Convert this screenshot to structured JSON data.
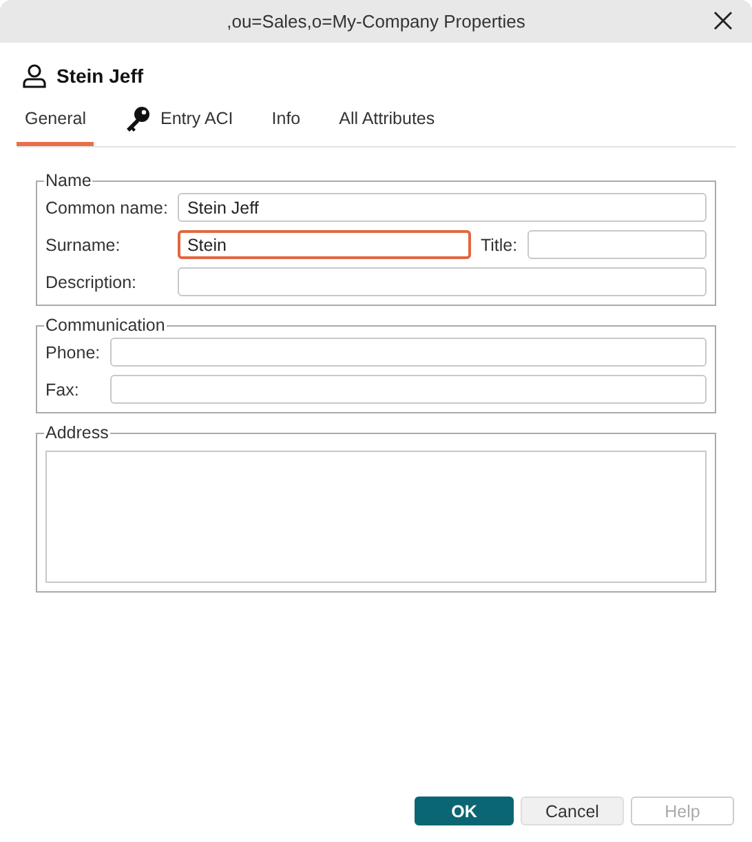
{
  "window": {
    "title": ",ou=Sales,o=My-Company Properties"
  },
  "header": {
    "name": "Stein Jeff"
  },
  "tabs": [
    {
      "label": "General",
      "selected": true,
      "kind": "text"
    },
    {
      "label": "Entry ACI",
      "selected": false,
      "kind": "key"
    },
    {
      "label": "Info",
      "selected": false,
      "kind": "text"
    },
    {
      "label": "All Attributes",
      "selected": false,
      "kind": "text"
    }
  ],
  "groups": [
    {
      "title": "Name",
      "kind": "form",
      "rows": [
        {
          "fields": [
            {
              "label": "Common name:",
              "value": "Stein Jeff",
              "focused": false
            }
          ]
        },
        {
          "fields": [
            {
              "label": "Surname:",
              "value": "Stein",
              "focused": true
            },
            {
              "label": "Title:",
              "focused": false
            }
          ]
        },
        {
          "fields": [
            {
              "label": "Description:",
              "focused": false
            }
          ]
        }
      ]
    },
    {
      "title": "Communication",
      "kind": "form",
      "rows": [
        {
          "fields": [
            {
              "label": "Phone:",
              "focused": false
            }
          ]
        },
        {
          "fields": [
            {
              "label": "Fax:",
              "focused": false
            }
          ]
        }
      ]
    },
    {
      "title": "Address",
      "kind": "textarea"
    }
  ],
  "buttons": [
    {
      "label": "OK",
      "kind": "primary",
      "disabled": false
    },
    {
      "label": "Cancel",
      "kind": "normal",
      "disabled": false
    },
    {
      "label": "Help",
      "kind": "normal",
      "disabled": true
    }
  ]
}
